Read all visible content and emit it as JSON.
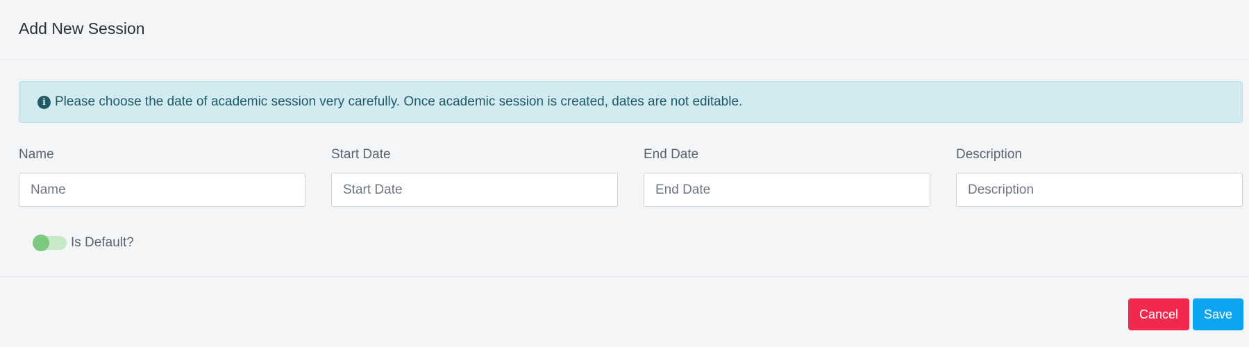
{
  "header": {
    "title": "Add New Session"
  },
  "alert": {
    "icon": "info-circle-icon",
    "text": "Please choose the date of academic session very carefully. Once academic session is created, dates are not editable."
  },
  "form": {
    "fields": [
      {
        "label": "Name",
        "placeholder": "Name"
      },
      {
        "label": "Start Date",
        "placeholder": "Start Date"
      },
      {
        "label": "End Date",
        "placeholder": "End Date"
      },
      {
        "label": "Description",
        "placeholder": "Description"
      }
    ],
    "is_default": {
      "label": "Is Default?",
      "checked": false
    }
  },
  "actions": {
    "cancel_label": "Cancel",
    "save_label": "Save"
  },
  "colors": {
    "alert_bg": "#d1ebf0",
    "toggle": "#7cc97f",
    "cancel": "#f2294e",
    "save": "#0ea5f0"
  }
}
